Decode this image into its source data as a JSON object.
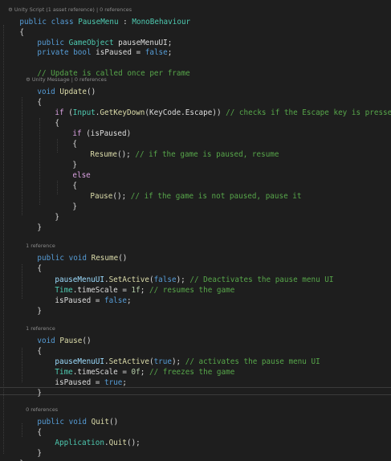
{
  "lenses": {
    "class": "Unity Script (1 asset reference) | 0 references",
    "update": "Unity Message | 0 references",
    "resume": "1 reference",
    "pause": "1 reference",
    "quit": "0 references"
  },
  "code": {
    "public": "public",
    "class": "class",
    "class_name": "PauseMenu",
    "colon": " : ",
    "base_class": "MonoBehaviour",
    "open_brace": "{",
    "close_brace": "}",
    "gameobject": "GameObject",
    "field_menu": " pauseMenuUI;",
    "private": "private",
    "bool": "bool",
    "field_paused": " isPaused = ",
    "false": "false",
    "true": "true",
    "semicolon": ";",
    "update_comment": "// Update is called once per frame",
    "void": "void",
    "update": "Update",
    "parens": "()",
    "if": "if",
    "else": "else",
    "if_open": " (",
    "input": "Input",
    "dot": ".",
    "getkeydown": "GetKeyDown",
    "keycode_arg": "(KeyCode.Escape)) ",
    "escape_comment": "// checks if the Escape key is pressed",
    "is_paused_cond": " (isPaused)",
    "resume": "Resume",
    "resume_call_rest": "(); ",
    "resume_comment": "// if the game is paused, resume",
    "pause": "Pause",
    "pause_comment": "// if the game is not paused, pause it",
    "pausemenuui": "pauseMenuUI",
    "setactive": "SetActive",
    "paren_open": "(",
    "close_stmt": "); ",
    "deactivate_comment": "// Deactivates the pause menu UI",
    "activate_comment": "// activates the pause menu UI",
    "time": "Time",
    "timescale": ".timeScale = ",
    "one_f": "1f",
    "zero_f": "0f",
    "resumes_comment": "// resumes the game",
    "freezes_comment": "// freezes the game",
    "ispaused_assign": "isPaused = ",
    "quit": "Quit",
    "application": "Application",
    "quit_call": "Quit",
    "empty_call": "();"
  },
  "colors": {
    "background": "#1e1e1e",
    "keyword": "#569cd6",
    "type": "#4ec9b0",
    "method": "#dcdcaa",
    "comment": "#57a64a",
    "control": "#d8a0df",
    "number": "#b5cea8"
  },
  "icons": {
    "unity": "unity-icon"
  }
}
